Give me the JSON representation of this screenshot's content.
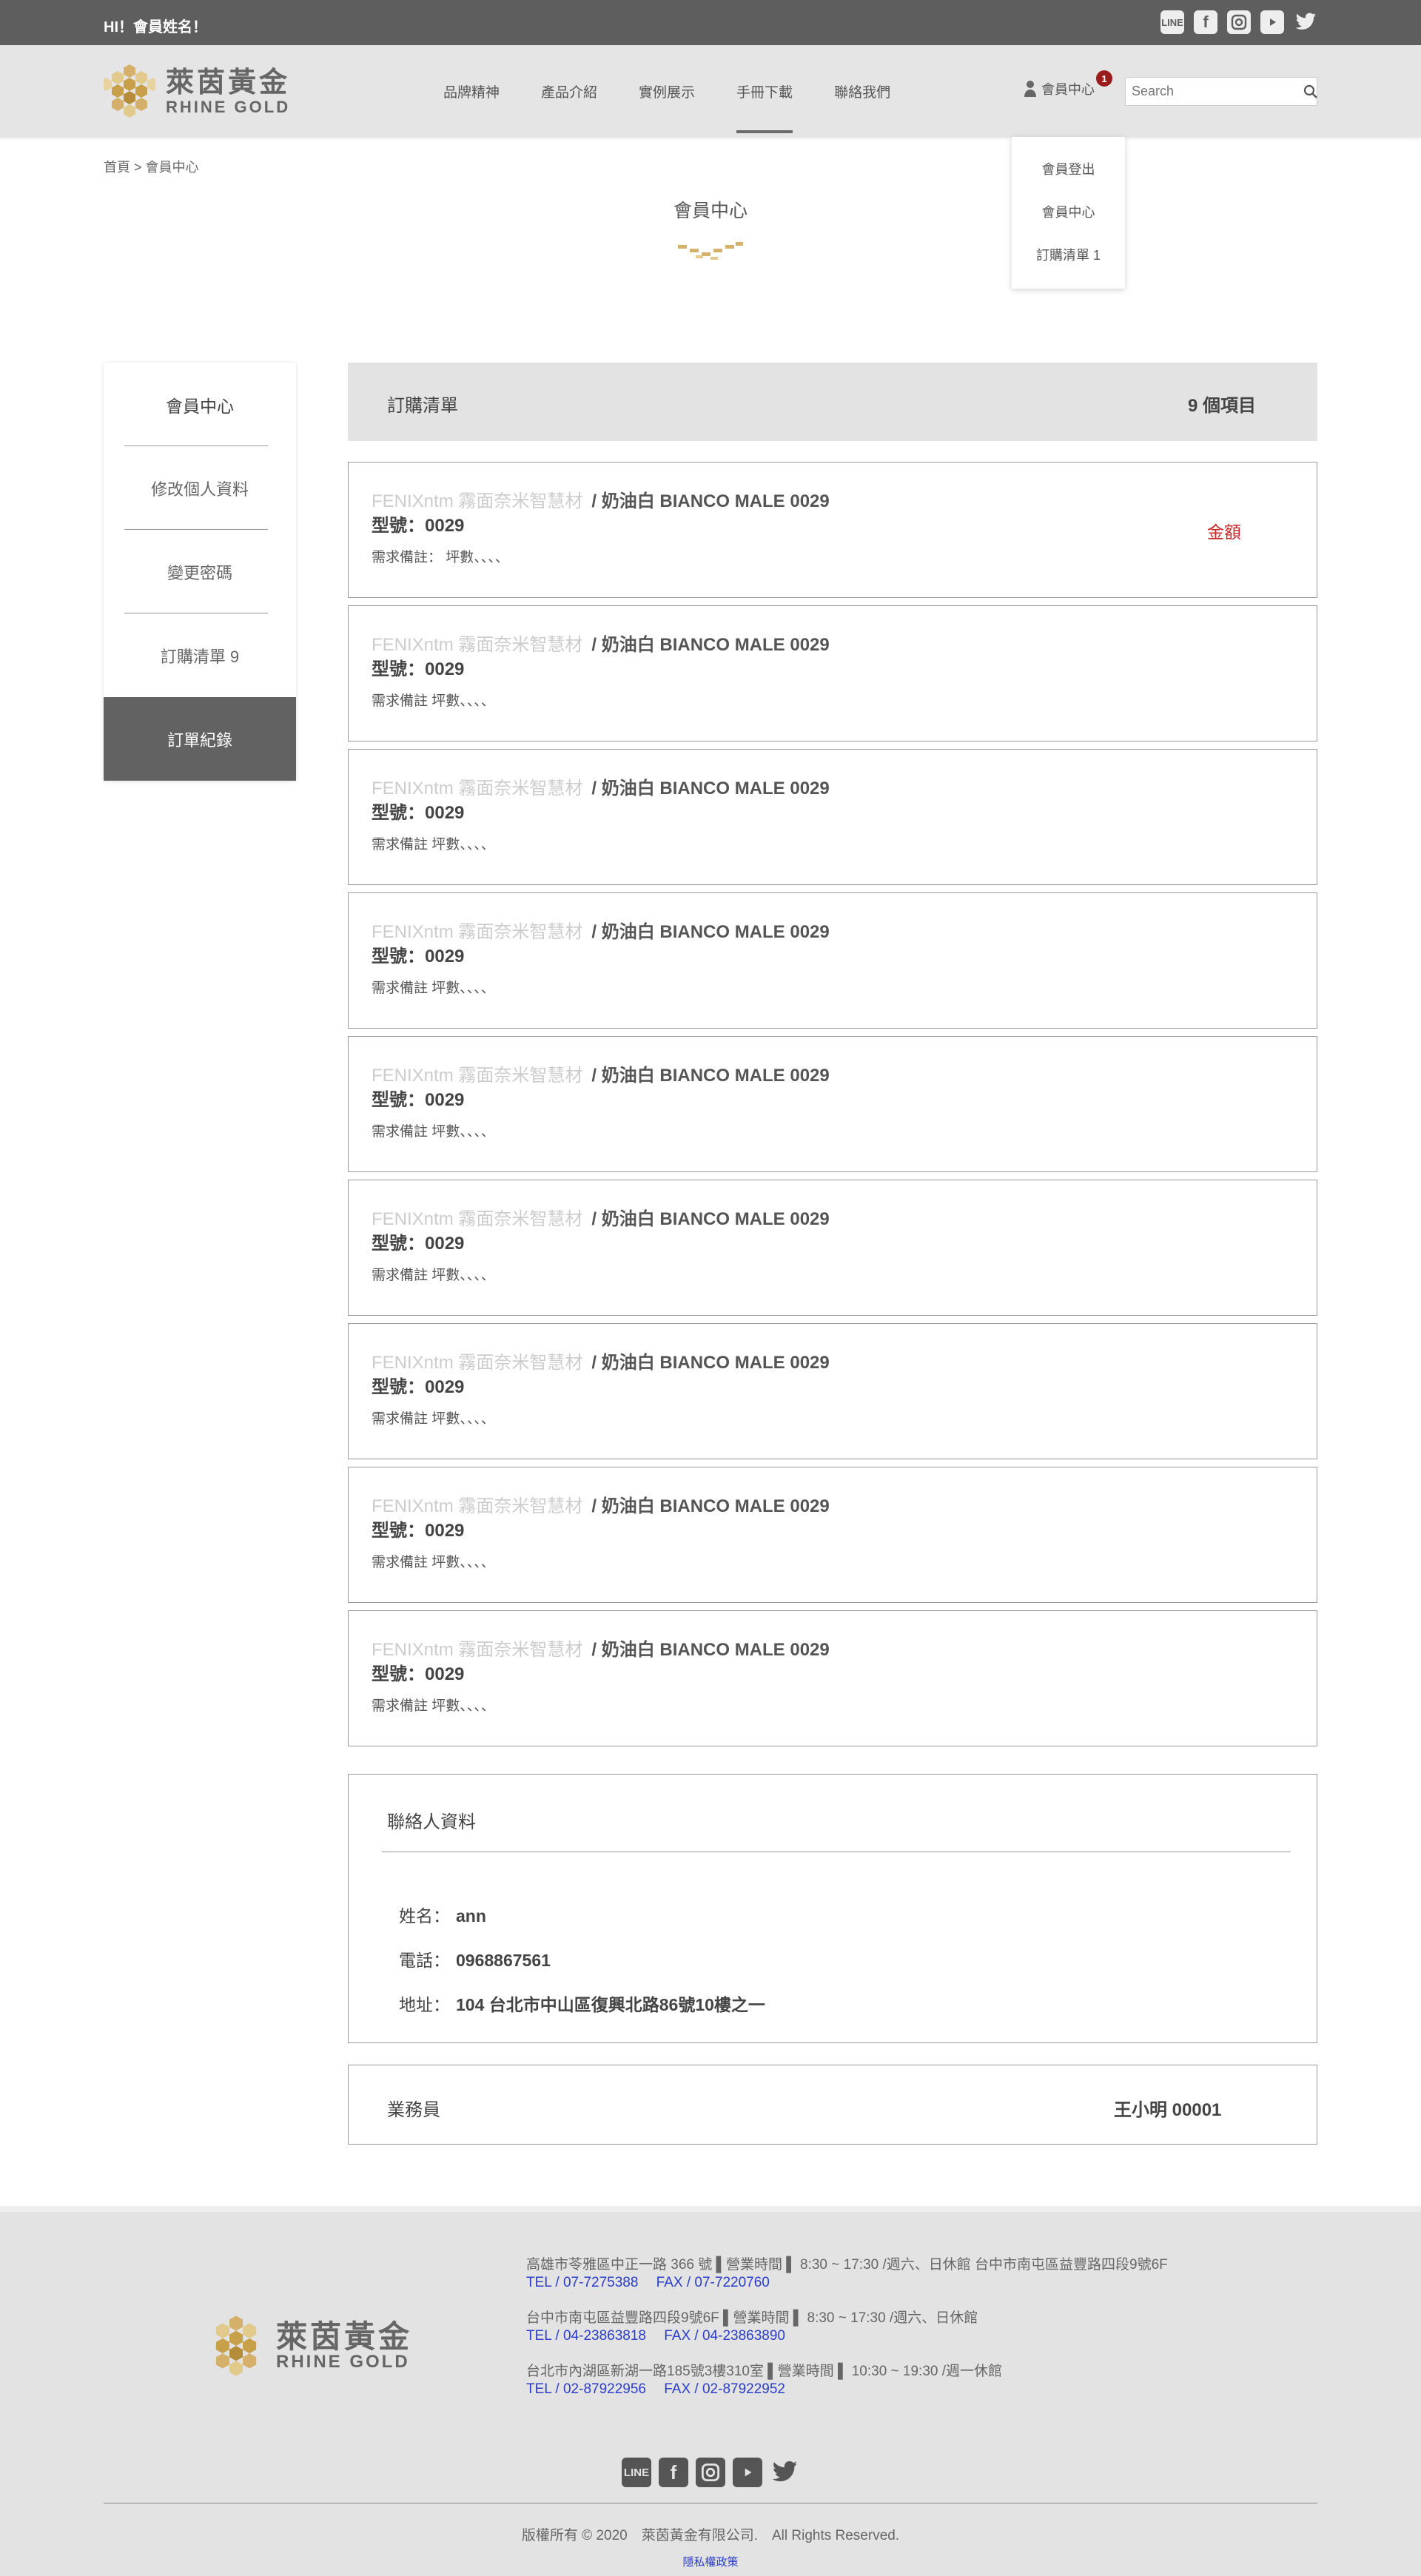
{
  "topbar": {
    "greeting": "HI！會員姓名！",
    "social": [
      "line-icon",
      "facebook-icon",
      "instagram-icon",
      "youtube-icon",
      "twitter-icon"
    ]
  },
  "header": {
    "logo_cn": "萊茵黃金",
    "logo_en": "RHINE GOLD",
    "nav": [
      "品牌精神",
      "產品介紹",
      "實例展示",
      "手冊下載",
      "聯絡我們"
    ],
    "member_label": "會員中心",
    "member_badge": "1",
    "search_placeholder": "Search"
  },
  "dropdown": {
    "items": [
      "會員登出",
      "會員中心",
      "訂購清單 1"
    ]
  },
  "breadcrumb": "首頁 > 會員中心",
  "page_title": "會員中心",
  "sidebar": {
    "title": "會員中心",
    "items": [
      "修改個人資料",
      "變更密碼",
      "訂購清單 9",
      "訂單紀錄"
    ]
  },
  "cart": {
    "title": "訂購清單",
    "count": "9 個項目",
    "amount_label": "金額",
    "items": [
      {
        "brand": "FENIXntm 霧面奈米智慧材",
        "spec": "/ 奶油白 BIANCO MALE 0029",
        "model": "型號：0029",
        "note": "需求備註： 坪數、、、、"
      },
      {
        "brand": "FENIXntm 霧面奈米智慧材",
        "spec": "/ 奶油白 BIANCO MALE 0029",
        "model": "型號：0029",
        "note": "需求備註 坪數、、、、"
      },
      {
        "brand": "FENIXntm 霧面奈米智慧材",
        "spec": "/ 奶油白 BIANCO MALE 0029",
        "model": "型號：0029",
        "note": "需求備註 坪數、、、、"
      },
      {
        "brand": "FENIXntm 霧面奈米智慧材",
        "spec": "/ 奶油白 BIANCO MALE 0029",
        "model": "型號：0029",
        "note": "需求備註 坪數、、、、"
      },
      {
        "brand": "FENIXntm 霧面奈米智慧材",
        "spec": "/ 奶油白 BIANCO MALE 0029",
        "model": "型號：0029",
        "note": "需求備註 坪數、、、、"
      },
      {
        "brand": "FENIXntm 霧面奈米智慧材",
        "spec": "/ 奶油白 BIANCO MALE 0029",
        "model": "型號：0029",
        "note": "需求備註 坪數、、、、"
      },
      {
        "brand": "FENIXntm 霧面奈米智慧材",
        "spec": "/ 奶油白 BIANCO MALE 0029",
        "model": "型號：0029",
        "note": "需求備註 坪數、、、、"
      },
      {
        "brand": "FENIXntm 霧面奈米智慧材",
        "spec": "/ 奶油白 BIANCO MALE 0029",
        "model": "型號：0029",
        "note": "需求備註 坪數、、、、"
      },
      {
        "brand": "FENIXntm 霧面奈米智慧材",
        "spec": "/ 奶油白 BIANCO MALE 0029",
        "model": "型號：0029",
        "note": "需求備註 坪數、、、、"
      }
    ]
  },
  "contact": {
    "title": "聯絡人資料",
    "name_label": "姓名：",
    "name": "ann",
    "phone_label": "電話：",
    "phone": "0968867561",
    "address_label": "地址：",
    "address": "104 台北市中山區復興北路86號10樓之一"
  },
  "sales": {
    "label": "業務員",
    "value": "王小明 00001"
  },
  "footer": {
    "logo_cn": "萊茵黃金",
    "logo_en": "RHINE GOLD",
    "branches": [
      {
        "addr": "高雄市苓雅區中正一路 366 號 ▌營業時間 ▌ 8:30 ~ 17:30 /週六、日休館 台中市南屯區益豐路四段9號6F",
        "tel": "TEL / 07-7275388　 FAX / 07-7220760"
      },
      {
        "addr": "台中市南屯區益豐路四段9號6F ▌營業時間 ▌ 8:30 ~ 17:30 /週六、日休館",
        "tel": "TEL / 04-23863818　 FAX / 04-23863890"
      },
      {
        "addr": "台北市內湖區新湖一路185號3樓310室 ▌營業時間 ▌ 10:30 ~ 19:30 /週一休館",
        "tel": "TEL / 02-87922956　 FAX / 02-87922952"
      }
    ],
    "copyright": "版權所有 © 2020　萊茵黃金有限公司.　All Rights Reserved.",
    "privacy": "隱私權政策"
  },
  "colors": {
    "topbar": "#5e5e5e",
    "header": "#e5e5e5",
    "gold": "#c9a04a",
    "amount": "#c62828",
    "link": "#2b3dc9"
  }
}
